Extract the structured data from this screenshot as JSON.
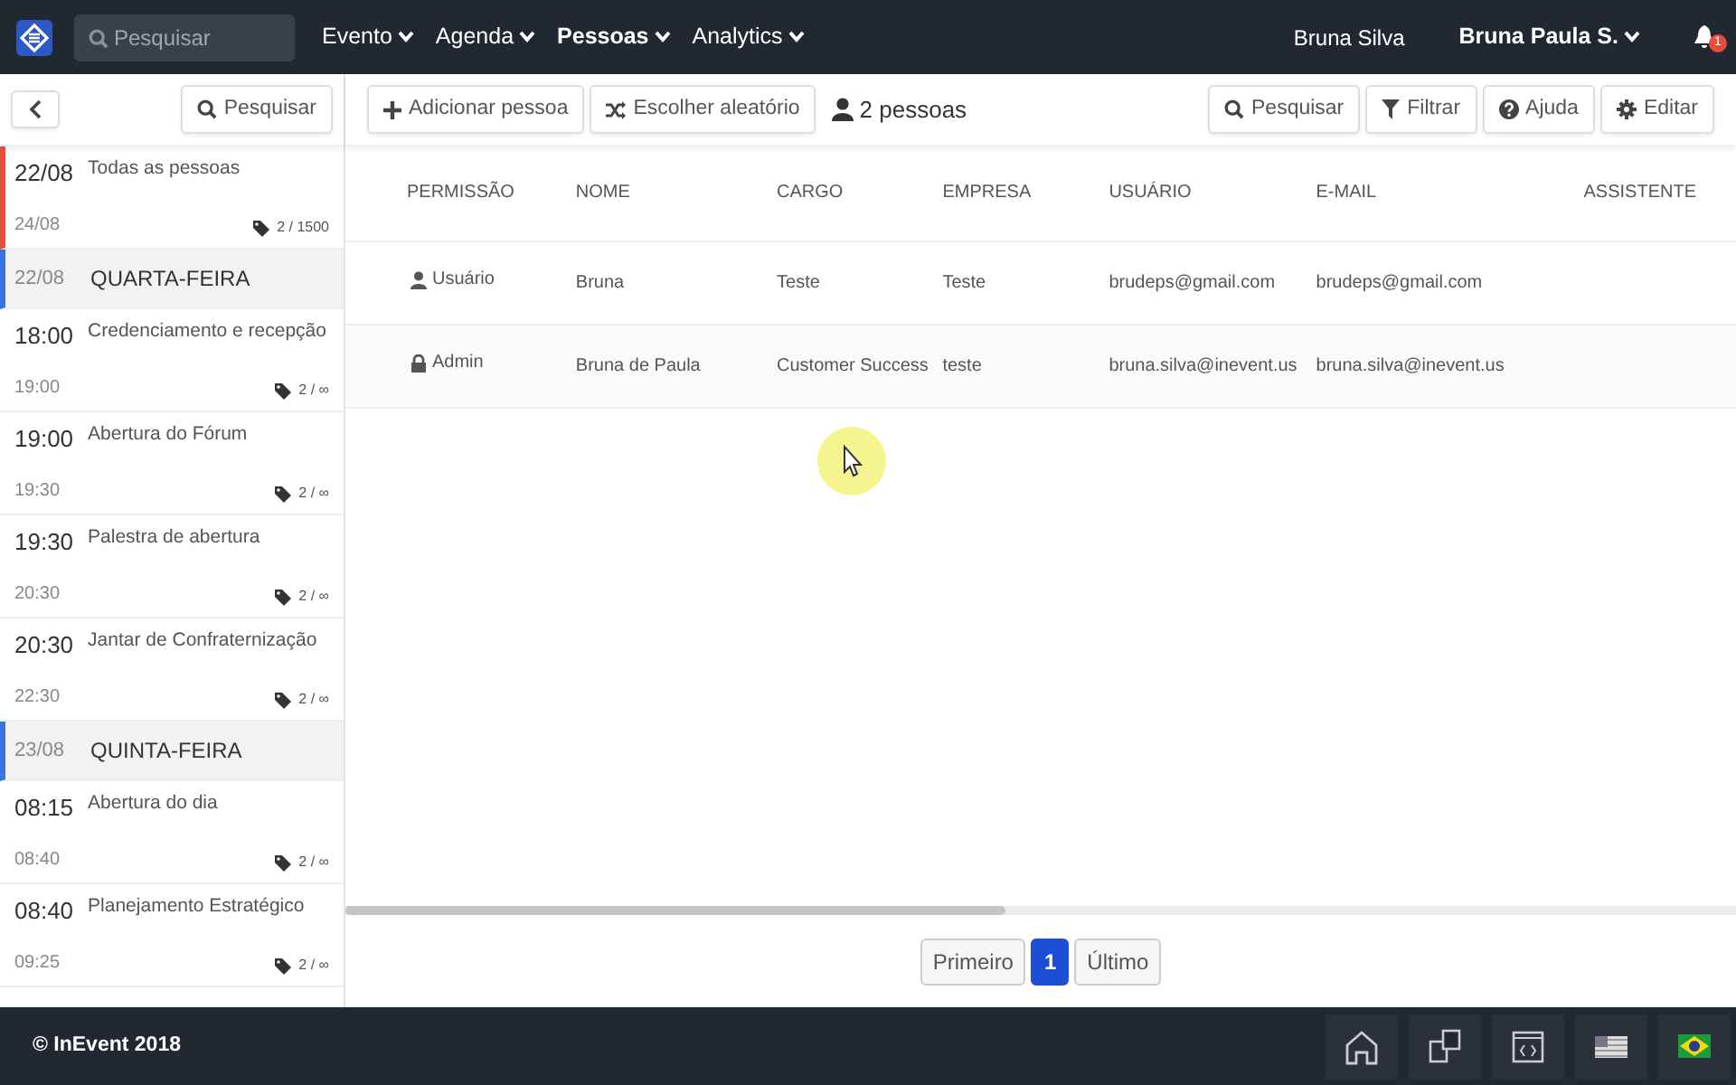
{
  "navbar": {
    "search_placeholder": "Pesquisar",
    "menus": [
      {
        "label": "Evento",
        "selected": false
      },
      {
        "label": "Agenda",
        "selected": false
      },
      {
        "label": "Pessoas",
        "selected": true
      },
      {
        "label": "Analytics",
        "selected": false
      }
    ],
    "user_name": "Bruna Silva",
    "account": "Bruna Paula S.",
    "notifications": "1"
  },
  "sidebar": {
    "search_button": "Pesquisar",
    "items": [
      {
        "kind": "all",
        "start": "22/08",
        "end": "24/08",
        "title": "Todas as pessoas",
        "count": "2 / 1500"
      },
      {
        "kind": "day",
        "start": "22/08",
        "title": "QUARTA-FEIRA"
      },
      {
        "kind": "session",
        "start": "18:00",
        "end": "19:00",
        "title": "Credenciamento e recepção",
        "count": "2 / ∞"
      },
      {
        "kind": "session",
        "start": "19:00",
        "end": "19:30",
        "title": "Abertura do Fórum",
        "count": "2 / ∞"
      },
      {
        "kind": "session",
        "start": "19:30",
        "end": "20:30",
        "title": "Palestra de abertura",
        "count": "2 / ∞"
      },
      {
        "kind": "session",
        "start": "20:30",
        "end": "22:30",
        "title": "Jantar de Confraternização",
        "count": "2 / ∞"
      },
      {
        "kind": "day",
        "start": "23/08",
        "title": "QUINTA-FEIRA"
      },
      {
        "kind": "session",
        "start": "08:15",
        "end": "08:40",
        "title": "Abertura do dia",
        "count": "2 / ∞"
      },
      {
        "kind": "session",
        "start": "08:40",
        "end": "09:25",
        "title": "Planejamento Estratégico",
        "count": "2 / ∞"
      }
    ]
  },
  "toolbar": {
    "left_buttons": [
      {
        "kind": "add",
        "label": "Adicionar pessoa"
      },
      {
        "kind": "shuffle",
        "label": "Escolher aleatório"
      }
    ],
    "people_count": "2 pessoas",
    "right_buttons": [
      {
        "kind": "search",
        "label": "Pesquisar"
      },
      {
        "kind": "filter",
        "label": "Filtrar"
      },
      {
        "kind": "help",
        "label": "Ajuda"
      },
      {
        "kind": "edit",
        "label": "Editar"
      }
    ]
  },
  "table": {
    "columns": [
      "PERMISSÃO",
      "NOME",
      "CARGO",
      "EMPRESA",
      "USUÁRIO",
      "E-MAIL",
      "ASSISTENTE"
    ],
    "rows": [
      {
        "kind": "user",
        "cells": [
          "Usuário",
          "Bruna",
          "Teste",
          "Teste",
          "brudeps@gmail.com",
          "brudeps@gmail.com"
        ]
      },
      {
        "kind": "admin",
        "cells": [
          "Admin",
          "Bruna de Paula",
          "Customer Success",
          "teste",
          "bruna.silva@inevent.us",
          "bruna.silva@inevent.us"
        ]
      }
    ]
  },
  "pagination": [
    {
      "label": "Primeiro",
      "selected": false
    },
    {
      "label": "1",
      "selected": true
    },
    {
      "label": "Último",
      "selected": false
    }
  ],
  "footer": {
    "copyright": "© InEvent 2018"
  }
}
